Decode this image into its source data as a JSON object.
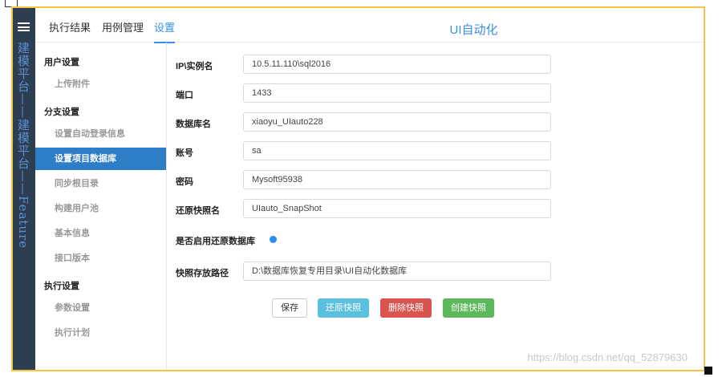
{
  "rail": {
    "title": "建模平台——建模平台——Feature"
  },
  "topnav": {
    "tabs": [
      {
        "label": "执行结果"
      },
      {
        "label": "用例管理"
      },
      {
        "label": "设置"
      }
    ],
    "app_title": "UI自动化"
  },
  "sidenav": {
    "groups": [
      {
        "label": "用户设置"
      },
      {
        "label": "分支设置"
      },
      {
        "label": "执行设置"
      }
    ],
    "items": [
      {
        "label": "上传附件"
      },
      {
        "label": "设置自动登录信息"
      },
      {
        "label": "设置项目数据库"
      },
      {
        "label": "同步根目录"
      },
      {
        "label": "构建用户池"
      },
      {
        "label": "基本信息"
      },
      {
        "label": "接口版本"
      },
      {
        "label": "参数设置"
      },
      {
        "label": "执行计划"
      }
    ]
  },
  "form": {
    "fields": [
      {
        "label": "IP\\实例名",
        "value": "10.5.11.110\\sql2016"
      },
      {
        "label": "端口",
        "value": "1433"
      },
      {
        "label": "数据库名",
        "value": "xiaoyu_UIauto228"
      },
      {
        "label": "账号",
        "value": "sa"
      },
      {
        "label": "密码",
        "value": "Mysoft95938"
      },
      {
        "label": "还原快照名",
        "value": "UIauto_SnapShot"
      }
    ],
    "toggle_label": "是否启用还原数据库",
    "path_label": "快照存放路径",
    "path_value": "D:\\数据库恢复专用目录\\UI自动化数据库"
  },
  "buttons": {
    "save": "保存",
    "restore": "还原快照",
    "delete": "删除快照",
    "create": "创建快照"
  },
  "colors": {
    "restore": "#5bc0de",
    "delete": "#d9534f",
    "create": "#5cb85c",
    "accent": "#3a8ee6"
  },
  "watermark": "https://blog.csdn.net/qq_52879630"
}
